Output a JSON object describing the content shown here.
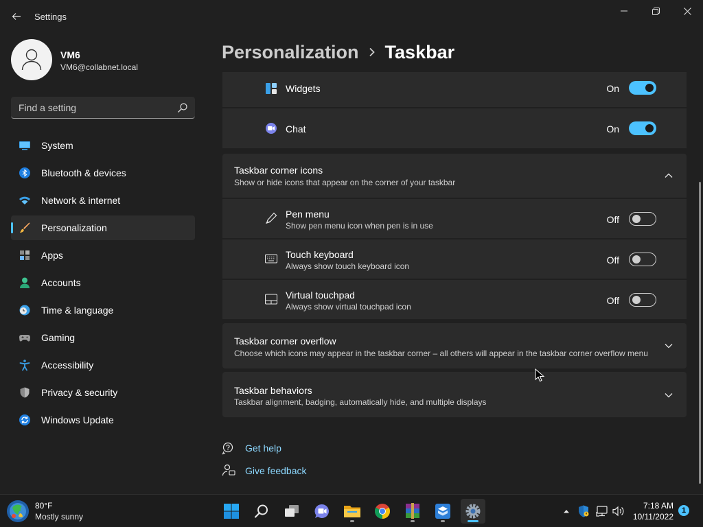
{
  "window": {
    "title": "Settings"
  },
  "profile": {
    "name": "VM6",
    "email": "VM6@collabnet.local"
  },
  "search": {
    "placeholder": "Find a setting"
  },
  "sidebar": {
    "items": [
      {
        "label": "System",
        "icon": "monitor-icon",
        "active": false
      },
      {
        "label": "Bluetooth & devices",
        "icon": "bluetooth-icon",
        "active": false
      },
      {
        "label": "Network & internet",
        "icon": "wifi-icon",
        "active": false
      },
      {
        "label": "Personalization",
        "icon": "brush-icon",
        "active": true
      },
      {
        "label": "Apps",
        "icon": "apps-icon",
        "active": false
      },
      {
        "label": "Accounts",
        "icon": "person-icon",
        "active": false
      },
      {
        "label": "Time & language",
        "icon": "clock-globe-icon",
        "active": false
      },
      {
        "label": "Gaming",
        "icon": "gamepad-icon",
        "active": false
      },
      {
        "label": "Accessibility",
        "icon": "accessibility-icon",
        "active": false
      },
      {
        "label": "Privacy & security",
        "icon": "shield-icon",
        "active": false
      },
      {
        "label": "Windows Update",
        "icon": "update-icon",
        "active": false
      }
    ]
  },
  "breadcrumb": {
    "parent": "Personalization",
    "current": "Taskbar"
  },
  "taskbar_items": [
    {
      "title": "Widgets",
      "state": "On",
      "on": true,
      "icon": "widgets-icon"
    },
    {
      "title": "Chat",
      "state": "On",
      "on": true,
      "icon": "chat-icon"
    }
  ],
  "corner_icons": {
    "title": "Taskbar corner icons",
    "description": "Show or hide icons that appear on the corner of your taskbar",
    "expanded": true,
    "items": [
      {
        "title": "Pen menu",
        "description": "Show pen menu icon when pen is in use",
        "state": "Off",
        "on": false,
        "icon": "pen-icon"
      },
      {
        "title": "Touch keyboard",
        "description": "Always show touch keyboard icon",
        "state": "Off",
        "on": false,
        "icon": "keyboard-icon"
      },
      {
        "title": "Virtual touchpad",
        "description": "Always show virtual touchpad icon",
        "state": "Off",
        "on": false,
        "icon": "touchpad-icon"
      }
    ]
  },
  "corner_overflow": {
    "title": "Taskbar corner overflow",
    "description": "Choose which icons may appear in the taskbar corner – all others will appear in the taskbar corner overflow menu",
    "expanded": false
  },
  "behaviors": {
    "title": "Taskbar behaviors",
    "description": "Taskbar alignment, badging, automatically hide, and multiple displays",
    "expanded": false
  },
  "help": {
    "get_help": "Get help",
    "give_feedback": "Give feedback"
  },
  "colors": {
    "accent": "#4cc2ff",
    "background": "#202020",
    "card": "#2b2b2b",
    "taskbar": "#1c1c1c"
  },
  "system_taskbar": {
    "weather": {
      "temp": "80°F",
      "desc": "Mostly sunny"
    },
    "apps": [
      "start-icon",
      "search-icon",
      "task-view-icon",
      "teams-chat-icon",
      "file-explorer-icon",
      "chrome-icon",
      "winrar-icon",
      "virtualbox-icon",
      "settings-icon"
    ],
    "tray": [
      "chevron-up-icon",
      "defender-icon",
      "network-icon",
      "volume-icon"
    ],
    "clock": {
      "time": "7:18 AM",
      "date": "10/11/2022"
    },
    "notifications": "1"
  }
}
